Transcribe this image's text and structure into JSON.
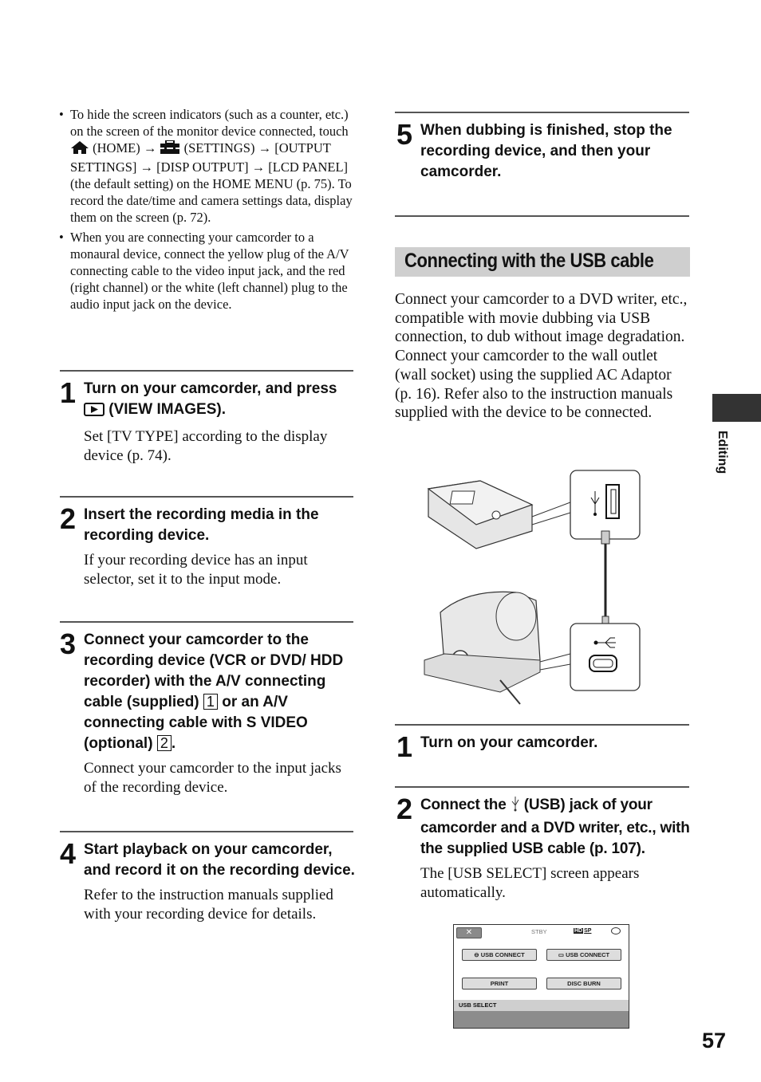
{
  "left": {
    "bullets": [
      {
        "seg1": "To hide the screen indicators (such as a counter, etc.) on the screen of the monitor device connected, touch",
        "home_label": "(HOME)",
        "settings_label": "(SETTINGS)",
        "seg2": "[OUTPUT SETTINGS]",
        "seg3": "[DISP OUTPUT]",
        "seg4": "[LCD PANEL] (the default setting) on the HOME MENU (p. 75). To record the date/time and camera settings data, display them on the screen (p. 72)."
      },
      {
        "text": "When you are connecting your camcorder to a monaural device, connect the yellow plug of the A/V connecting cable to the video input jack, and the red (right channel) or the white (left channel) plug to the audio input jack on the device."
      }
    ],
    "steps": [
      {
        "num": "1",
        "title_a": "Turn on your camcorder, and press",
        "title_b": "(VIEW IMAGES).",
        "body": "Set [TV TYPE] according to the display device (p. 74)."
      },
      {
        "num": "2",
        "title": "Insert the recording media in the recording device.",
        "body": "If your recording device has an input selector, set it to the input mode."
      },
      {
        "num": "3",
        "title_a": "Connect your camcorder to the recording device (VCR or DVD/ HDD recorder) with the A/V connecting cable (supplied)",
        "box1": "1",
        "title_b": "or an A/V connecting cable with S VIDEO (optional)",
        "box2": "2",
        "title_c": ".",
        "body": "Connect your camcorder to the input jacks of the recording device."
      },
      {
        "num": "4",
        "title": "Start playback on your camcorder, and record it on the recording device.",
        "body": "Refer to the instruction manuals supplied with your recording device for details."
      }
    ]
  },
  "right": {
    "step5": {
      "num": "5",
      "title": "When dubbing is finished, stop the recording device, and then your camcorder."
    },
    "section_title": "Connecting with the USB cable",
    "intro_p1": "Connect your camcorder to a DVD writer, etc., compatible with movie dubbing via USB connection, to dub without image degradation.",
    "intro_p2": "Connect your camcorder to the wall outlet (wall socket) using the supplied AC Adaptor (p. 16). Refer also to the instruction manuals supplied with the device to be connected.",
    "steps": [
      {
        "num": "1",
        "title": "Turn on your camcorder."
      },
      {
        "num": "2",
        "title_a": "Connect the",
        "title_b": "(USB) jack of your camcorder and a DVD writer, etc., with the supplied USB cable (p. 107).",
        "body": "The [USB SELECT] screen appears automatically."
      }
    ],
    "lcd": {
      "close": "✕",
      "status": "STBY",
      "hd": "HD",
      "sp": "SP",
      "buttons": [
        "USB CONNECT",
        "USB CONNECT",
        "PRINT",
        "DISC BURN"
      ],
      "bar_label": "USB SELECT"
    }
  },
  "side_tab_label": "Editing",
  "page_number": "57"
}
